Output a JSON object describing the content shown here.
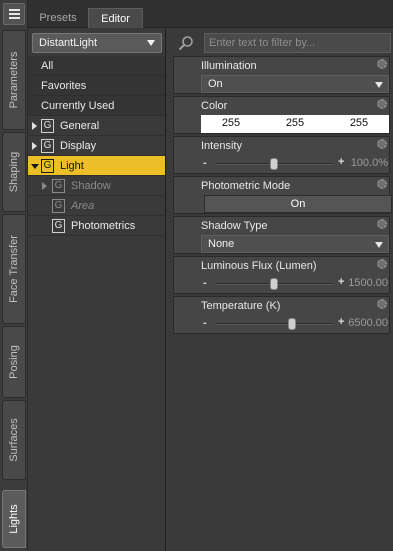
{
  "side_tabs": [
    "Parameters",
    "Shaping",
    "Face Transfer",
    "Posing",
    "Surfaces",
    "Lights"
  ],
  "active_side_tab": "Lights",
  "top_tabs": [
    "Presets",
    "Editor"
  ],
  "active_top_tab": "Editor",
  "left": {
    "node_select": "DistantLight",
    "groups": [
      "All",
      "Favorites",
      "Currently Used"
    ],
    "tree": [
      {
        "label": "General",
        "expanded": false,
        "selected": false,
        "dim": false
      },
      {
        "label": "Display",
        "expanded": false,
        "selected": false,
        "dim": false
      },
      {
        "label": "Light",
        "expanded": true,
        "selected": true,
        "dim": false
      },
      {
        "label": "Shadow",
        "expanded": false,
        "selected": false,
        "dim": true
      },
      {
        "label": "Area",
        "expanded": false,
        "selected": false,
        "dim": true
      },
      {
        "label": "Photometrics",
        "expanded": false,
        "selected": false,
        "dim": false
      }
    ],
    "group_icon": "G"
  },
  "filter": {
    "placeholder": "Enter text to filter by..."
  },
  "props": {
    "illumination": {
      "name": "Illumination",
      "value": "On"
    },
    "color": {
      "name": "Color",
      "r": "255",
      "g": "255",
      "b": "255"
    },
    "intensity": {
      "name": "Intensity",
      "value": "100.0%",
      "level": 0.5
    },
    "photometric": {
      "name": "Photometric Mode",
      "value": "On"
    },
    "shadow_type": {
      "name": "Shadow Type",
      "value": "None"
    },
    "flux": {
      "name": "Luminous Flux (Lumen)",
      "value": "1500.00",
      "level": 0.5
    },
    "temperature": {
      "name": "Temperature (K)",
      "value": "6500.00",
      "level": 0.65
    },
    "minus": "-",
    "plus": "+"
  },
  "colors": {
    "selected_row": "#ecbf28",
    "panel": "#3a3a3a"
  }
}
